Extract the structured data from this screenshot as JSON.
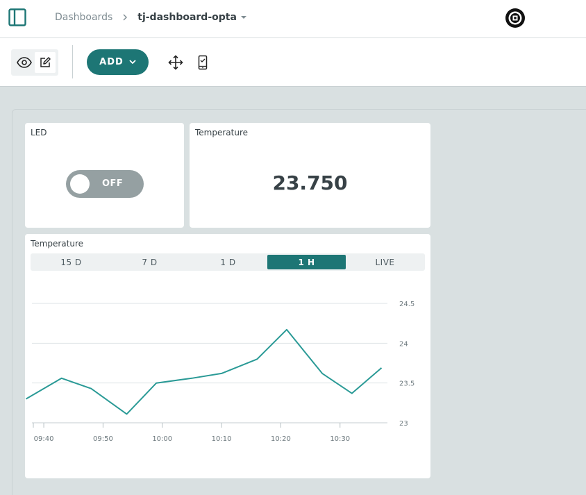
{
  "breadcrumb": {
    "parent": "Dashboards",
    "current": "tj-dashboard-opta"
  },
  "toolbar": {
    "add_label": "ADD"
  },
  "widgets": {
    "led": {
      "title": "LED",
      "switch_state": "OFF"
    },
    "temperature_value": {
      "title": "Temperature",
      "value": "23.750"
    },
    "temperature_chart": {
      "title": "Temperature",
      "tabs": [
        "15 D",
        "7 D",
        "1 D",
        "1 H",
        "LIVE"
      ],
      "active_tab": "1 H"
    }
  },
  "colors": {
    "accent": "#1d7675",
    "switch_off": "#95a0a2",
    "line": "#2a9a96",
    "background": "#d9e0e1"
  },
  "chart_data": {
    "type": "line",
    "title": "",
    "xlabel": "",
    "ylabel": "",
    "x": [
      "09:37",
      "09:43",
      "09:48",
      "09:54",
      "09:59",
      "10:05",
      "10:10",
      "10:16",
      "10:21",
      "10:27",
      "10:32",
      "10:37"
    ],
    "y": [
      23.3,
      23.56,
      23.43,
      23.11,
      23.5,
      23.56,
      23.62,
      23.8,
      24.17,
      23.62,
      23.37,
      23.69
    ],
    "x_ticks": [
      "09:40",
      "09:50",
      "10:00",
      "10:10",
      "10:20",
      "10:30"
    ],
    "y_ticks": [
      "23",
      "23.5",
      "24",
      "24.5"
    ],
    "ylim": [
      23,
      24.5
    ],
    "grid": true,
    "legend": "none"
  }
}
